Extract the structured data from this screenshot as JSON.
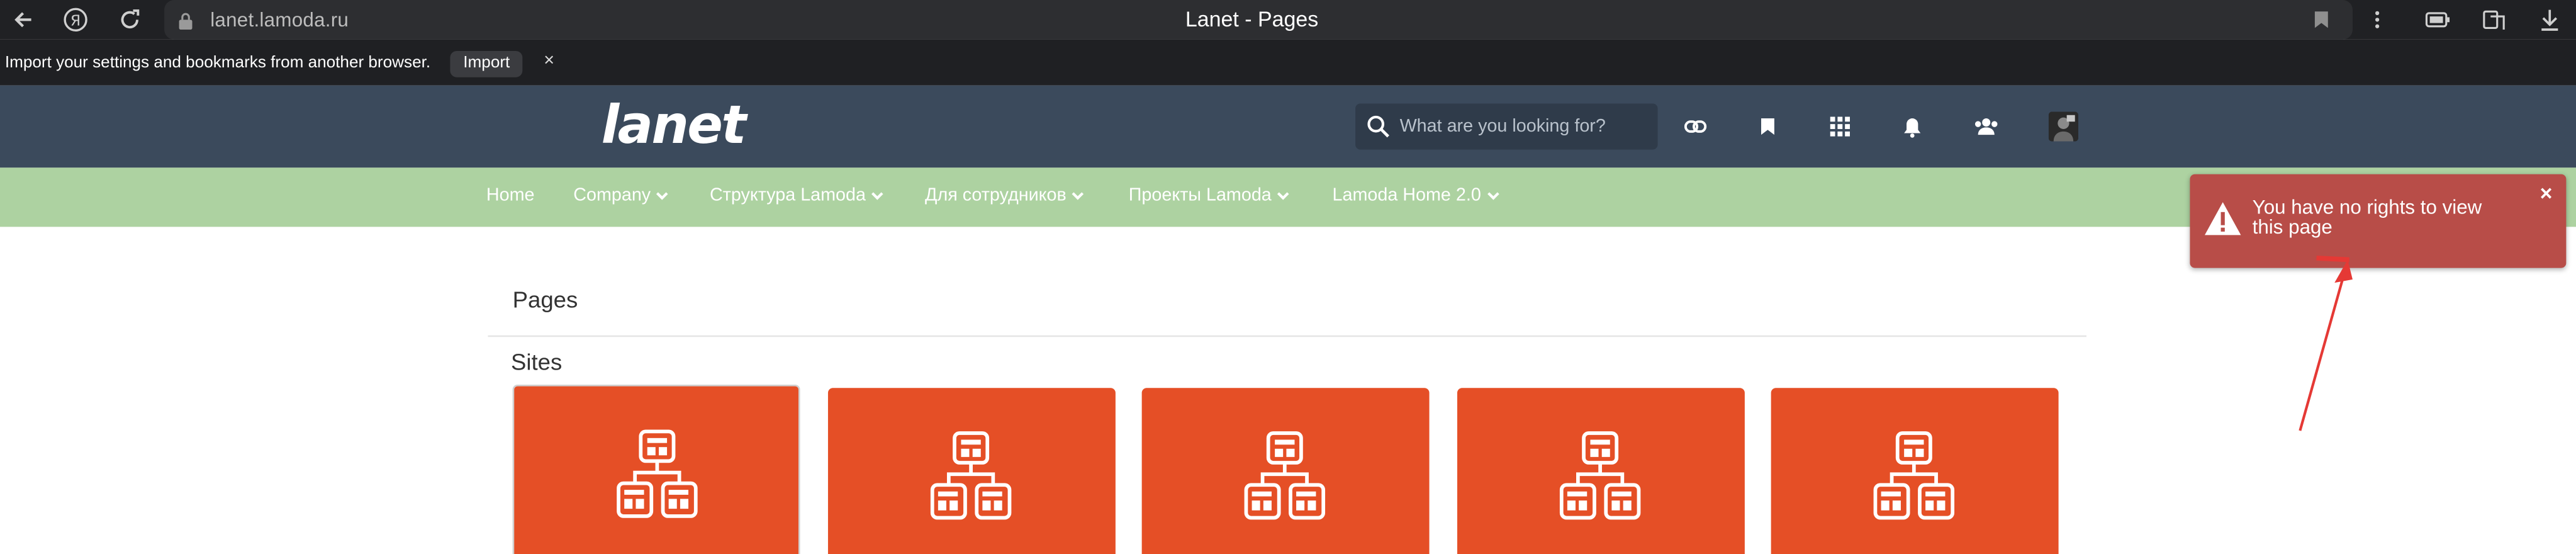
{
  "browser": {
    "url": "lanet.lamoda.ru",
    "tab_title": "Lanet - Pages"
  },
  "import_bar": {
    "message": "Import your settings and bookmarks from another browser.",
    "import_label": "Import",
    "close_label": "×"
  },
  "header": {
    "logo": "lanet",
    "search_placeholder": "What are you looking for?"
  },
  "nav": {
    "items": [
      {
        "label": "Home",
        "has_caret": false
      },
      {
        "label": "Company",
        "has_caret": true
      },
      {
        "label": "Структура Lamoda",
        "has_caret": true
      },
      {
        "label": "Для сотрудников",
        "has_caret": true
      },
      {
        "label": "Проекты Lamoda",
        "has_caret": true
      },
      {
        "label": "Lamoda Home 2.0",
        "has_caret": true
      }
    ]
  },
  "content": {
    "pages_title": "Pages",
    "sites_title": "Sites",
    "tile_count": 5
  },
  "toast": {
    "message": "You have no rights to view this page",
    "close_label": "×"
  },
  "colors": {
    "header_bg": "#3b4a5c",
    "nav_bg": "#add2a1",
    "tile_bg": "#e54f26",
    "toast_bg": "#b84d48",
    "annotation_arrow": "#e53935"
  }
}
